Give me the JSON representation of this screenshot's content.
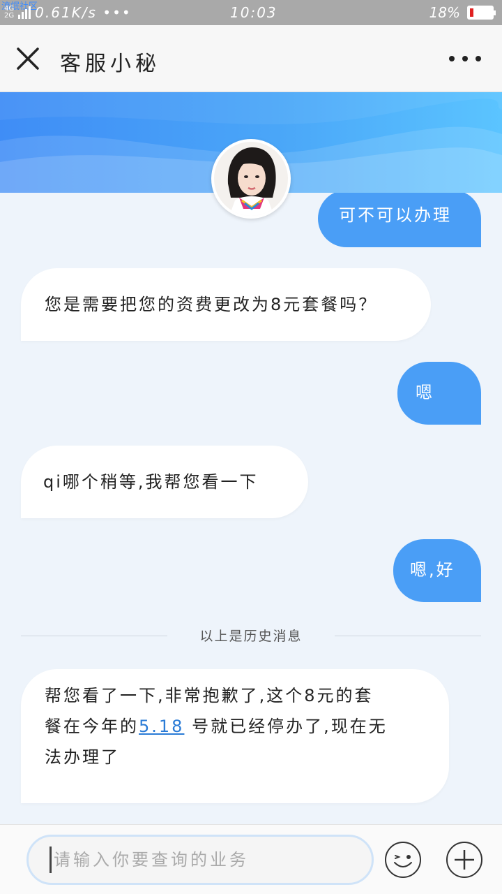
{
  "status_bar": {
    "watermark": "流氓社区",
    "net_top": "4G",
    "net_bottom": "2G",
    "speed": "0.61K/s •••",
    "time": "10:03",
    "battery": "18%",
    "battery_level": 0.18
  },
  "header": {
    "title": "客服小秘"
  },
  "messages": [
    {
      "from": "user",
      "text": "可不可以办理"
    },
    {
      "from": "bot",
      "text": "您是需要把您的资费更改为8元套餐吗？"
    },
    {
      "from": "user",
      "text": "嗯"
    },
    {
      "from": "bot",
      "text": "qi哪个稍等,我帮您看一下"
    },
    {
      "from": "user",
      "text": "嗯,好"
    }
  ],
  "history_divider": "以上是历史消息",
  "last_message": {
    "line1": "帮您看了一下,非常抱歉了,这个8元的套",
    "line2_prefix": "餐在今年的",
    "line2_link": "5.18",
    "line2_suffix": " 号就已经停办了,现在无",
    "line3": "法办理了"
  },
  "input": {
    "placeholder": "请输入你要查询的业务"
  },
  "colors": {
    "accent": "#4a9ef6",
    "link": "#2a7bd6",
    "banner_start": "#3f8df6",
    "banner_end": "#5bc4ff"
  }
}
